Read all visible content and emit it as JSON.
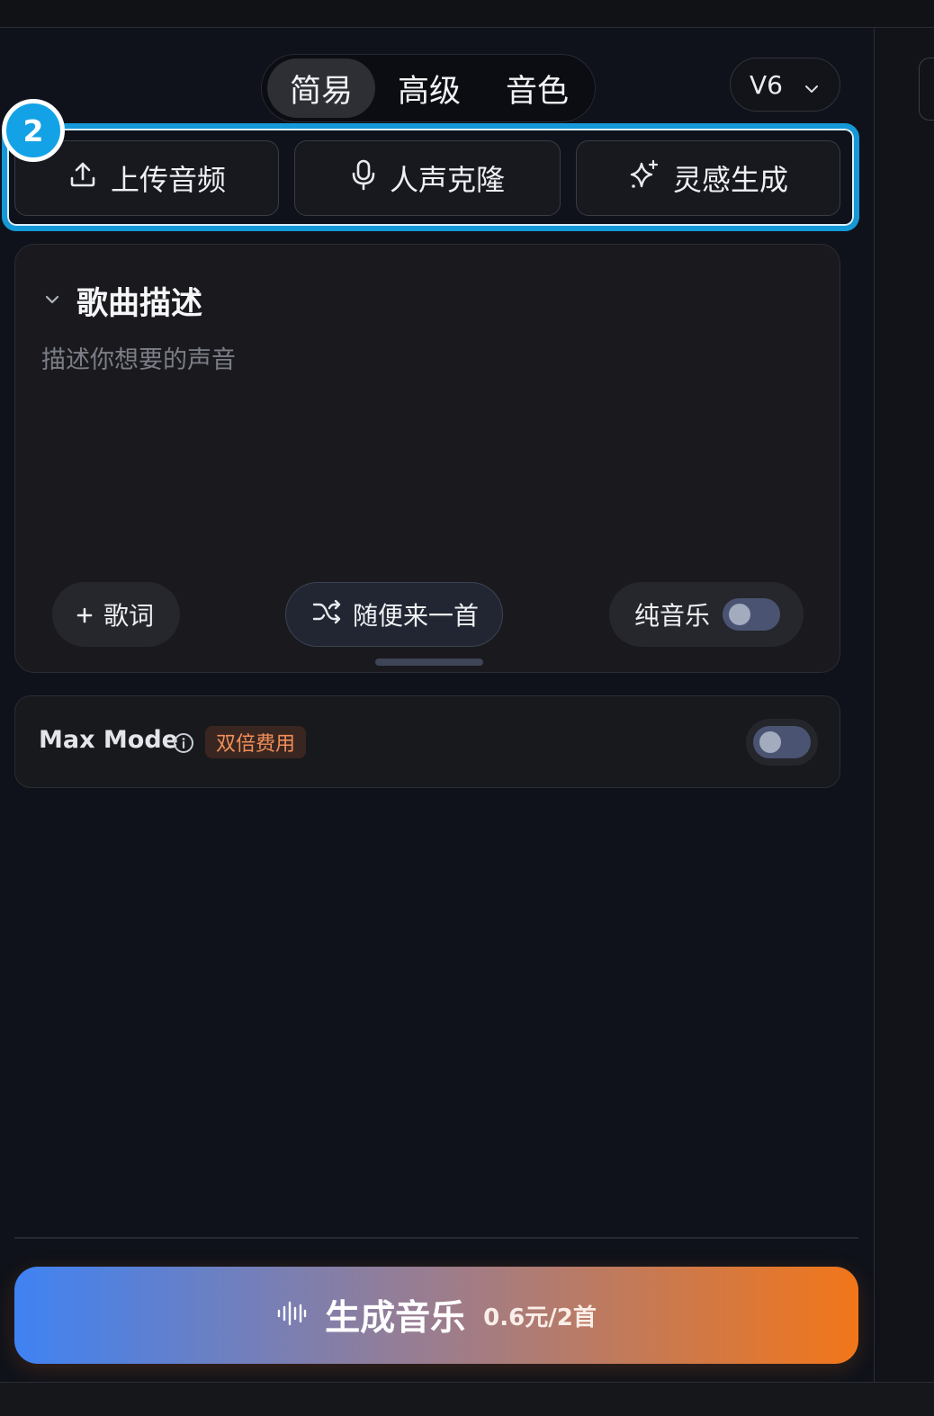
{
  "mode_tabs": [
    {
      "label": "简易",
      "active": true
    },
    {
      "label": "高级",
      "active": false
    },
    {
      "label": "音色",
      "active": false
    }
  ],
  "version": {
    "label": "V6",
    "icon": "chevron-down-icon"
  },
  "step_badge": "2",
  "tools": [
    {
      "label": "上传音频",
      "icon": "upload-icon"
    },
    {
      "label": "人声克隆",
      "icon": "microphone-icon"
    },
    {
      "label": "灵感生成",
      "icon": "sparkle-icon"
    }
  ],
  "description": {
    "title": "歌曲描述",
    "placeholder": "描述你想要的声音",
    "lyrics_button": "歌词",
    "random_button": "随便来一首",
    "instrumental_label": "纯音乐",
    "instrumental_on": false
  },
  "max_mode": {
    "label": "Max Mode",
    "badge": "双倍费用",
    "enabled": false
  },
  "generate": {
    "label": "生成音乐",
    "price": "0.6元/2首",
    "icon": "waveform-icon"
  },
  "colors": {
    "accent_blue": "#1598d8",
    "gradient_start": "#3f82f3",
    "gradient_end": "#f27619",
    "cost_badge_text": "#f08f5a"
  }
}
